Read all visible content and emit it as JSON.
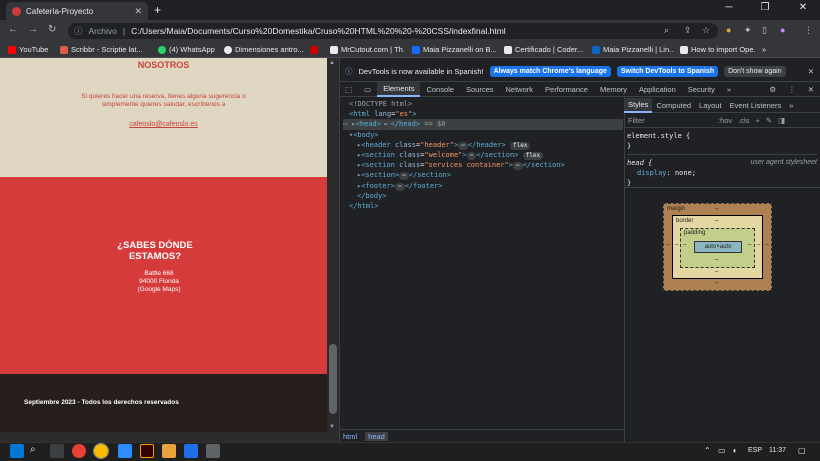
{
  "window": {
    "tab_title": "Cafetería-Proyecto",
    "new_tab": "+",
    "controls": [
      "─",
      "❐",
      "✕"
    ]
  },
  "address": {
    "scheme_label": "Archivo",
    "url": "C:/Users/Maia/Documents/Curso%20Domestika/Cruso%20HTML%20%20-%20CSS/indexfinal.html"
  },
  "bookmarks": [
    {
      "label": "YouTube",
      "color": "#ff0000"
    },
    {
      "label": "Scribbr - Scriptie lat...",
      "color": "#e05a47"
    },
    {
      "label": "(4) WhatsApp",
      "color": "#25d366"
    },
    {
      "label": "Dimensiones antro...",
      "color": "#e8eaed"
    },
    {
      "label": "",
      "color": "#cc0000"
    },
    {
      "label": "MrCutout.com | Th...",
      "color": "#e8eaed"
    },
    {
      "label": "Maia Pizzanelli on B...",
      "color": "#1769ff"
    },
    {
      "label": "Certificado | Coder...",
      "color": "#e8eaed"
    },
    {
      "label": "Maia Pizzanelli | Lin...",
      "color": "#0a66c2"
    },
    {
      "label": "How to import Ope...",
      "color": "#e8eaed"
    }
  ],
  "page": {
    "nosotros_title": "NOSOTROS",
    "nosotros_text_1": "Si quieres hacer una reserva, tienes alguna sugerencia o",
    "nosotros_text_2": "simplemente quieres saludar, escríbenos a",
    "email": "cafeoslo@cafeoslo.es",
    "location_title_1": "¿SABES DÓNDE",
    "location_title_2": "ESTAMOS?",
    "address_1": "Battle 668",
    "address_2": "94000 Florida",
    "address_3": "(Google Maps)",
    "footer": "Septiembre 2023 - Todos los derechos reservados"
  },
  "devtools": {
    "info_text": "DevTools is now available in Spanish!",
    "btn_match": "Always match Chrome's language",
    "btn_switch": "Switch DevTools to Spanish",
    "btn_dont": "Don't show again",
    "tabs": [
      "Elements",
      "Console",
      "Sources",
      "Network",
      "Performance",
      "Memory",
      "Application",
      "Security"
    ],
    "more": "»",
    "dom": {
      "doctype": "<!DOCTYPE html>",
      "html_open": "<html",
      "lang_attr": "lang",
      "lang_val": "\"es\"",
      "head": "<head>",
      "head_close": "</head>",
      "eq": "== $0",
      "body": "<body>",
      "header": "<header",
      "header_class": "\"header\"",
      "header_close": "</header>",
      "section_welcome": "\"welcome\"",
      "section_services": "\"services container\"",
      "section_tag": "<section",
      "section_close": "</section>",
      "section_plain": "<section>",
      "footer": "<footer>",
      "footer_close": "</footer>",
      "body_close": "</body>",
      "html_close": "</html>",
      "class_attr": "class",
      "ellipsis": "⋯",
      "flex": "flex",
      "gt": ">"
    },
    "subtabs": [
      "Styles",
      "Computed",
      "Layout",
      "Event Listeners"
    ],
    "filter": "Filter",
    "hov": ":hov",
    "cls": ".cls",
    "rules": {
      "element_style": "element.style {",
      "brace_close": "}",
      "head_rule": "head {",
      "ua": "user agent stylesheet",
      "display_prop": "display",
      "display_val": "none;"
    },
    "boxmodel": {
      "margin": "margin",
      "border": "border",
      "padding": "padding",
      "dash": "–",
      "content": "auto×auto"
    },
    "breadcrumbs": [
      "html",
      "head"
    ]
  },
  "taskbar": {
    "lang": "ESP",
    "time": "11:37"
  }
}
